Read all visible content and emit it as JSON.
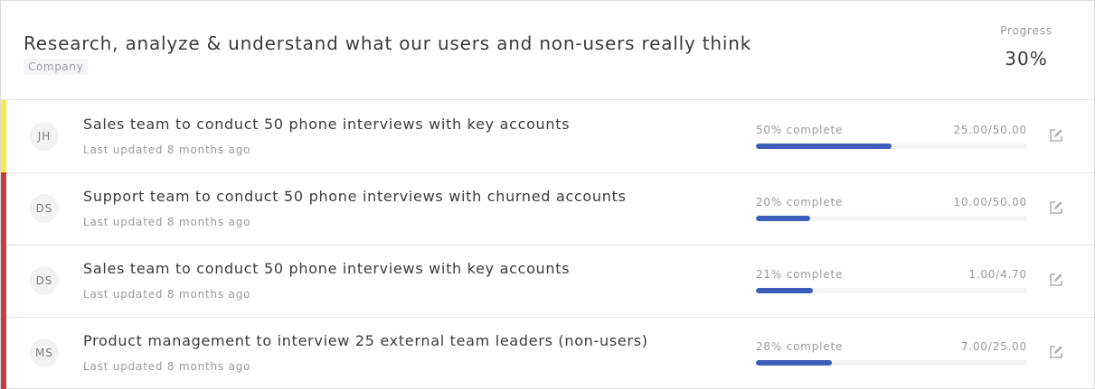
{
  "objective": {
    "title": "Research, analyze & understand what our users and non-users really think",
    "tag": "Company",
    "progress_label": "Progress",
    "progress_value": "30%"
  },
  "colors": {
    "accent_bar": "#3b5eb8",
    "status_yellow": "#f5ec4a",
    "status_red": "#c43d3f"
  },
  "key_results": [
    {
      "initials": "JH",
      "title": "Sales team to conduct 50 phone interviews with key accounts",
      "updated": "Last updated 8 months ago",
      "percent_text": "50% complete",
      "ratio": "25.00/50.00",
      "progress": 0.5,
      "status_color": "#f5ec4a",
      "icon": "edit-icon"
    },
    {
      "initials": "DS",
      "title": "Support team to conduct 50 phone interviews with churned accounts",
      "updated": "Last updated 8 months ago",
      "percent_text": "20% complete",
      "ratio": "10.00/50.00",
      "progress": 0.2,
      "status_color": "#c43d3f",
      "icon": "edit-icon"
    },
    {
      "initials": "DS",
      "title": "Sales team to conduct 50 phone interviews with key accounts",
      "updated": "Last updated 8 months ago",
      "percent_text": "21% complete",
      "ratio": "1.00/4.70",
      "progress": 0.21,
      "status_color": "#c43d3f",
      "icon": "edit-icon"
    },
    {
      "initials": "MS",
      "title": "Product management to interview 25 external team leaders (non-users)",
      "updated": "Last updated 8 months ago",
      "percent_text": "28% complete",
      "ratio": "7.00/25.00",
      "progress": 0.28,
      "status_color": "#c43d3f",
      "icon": "edit-icon"
    }
  ]
}
